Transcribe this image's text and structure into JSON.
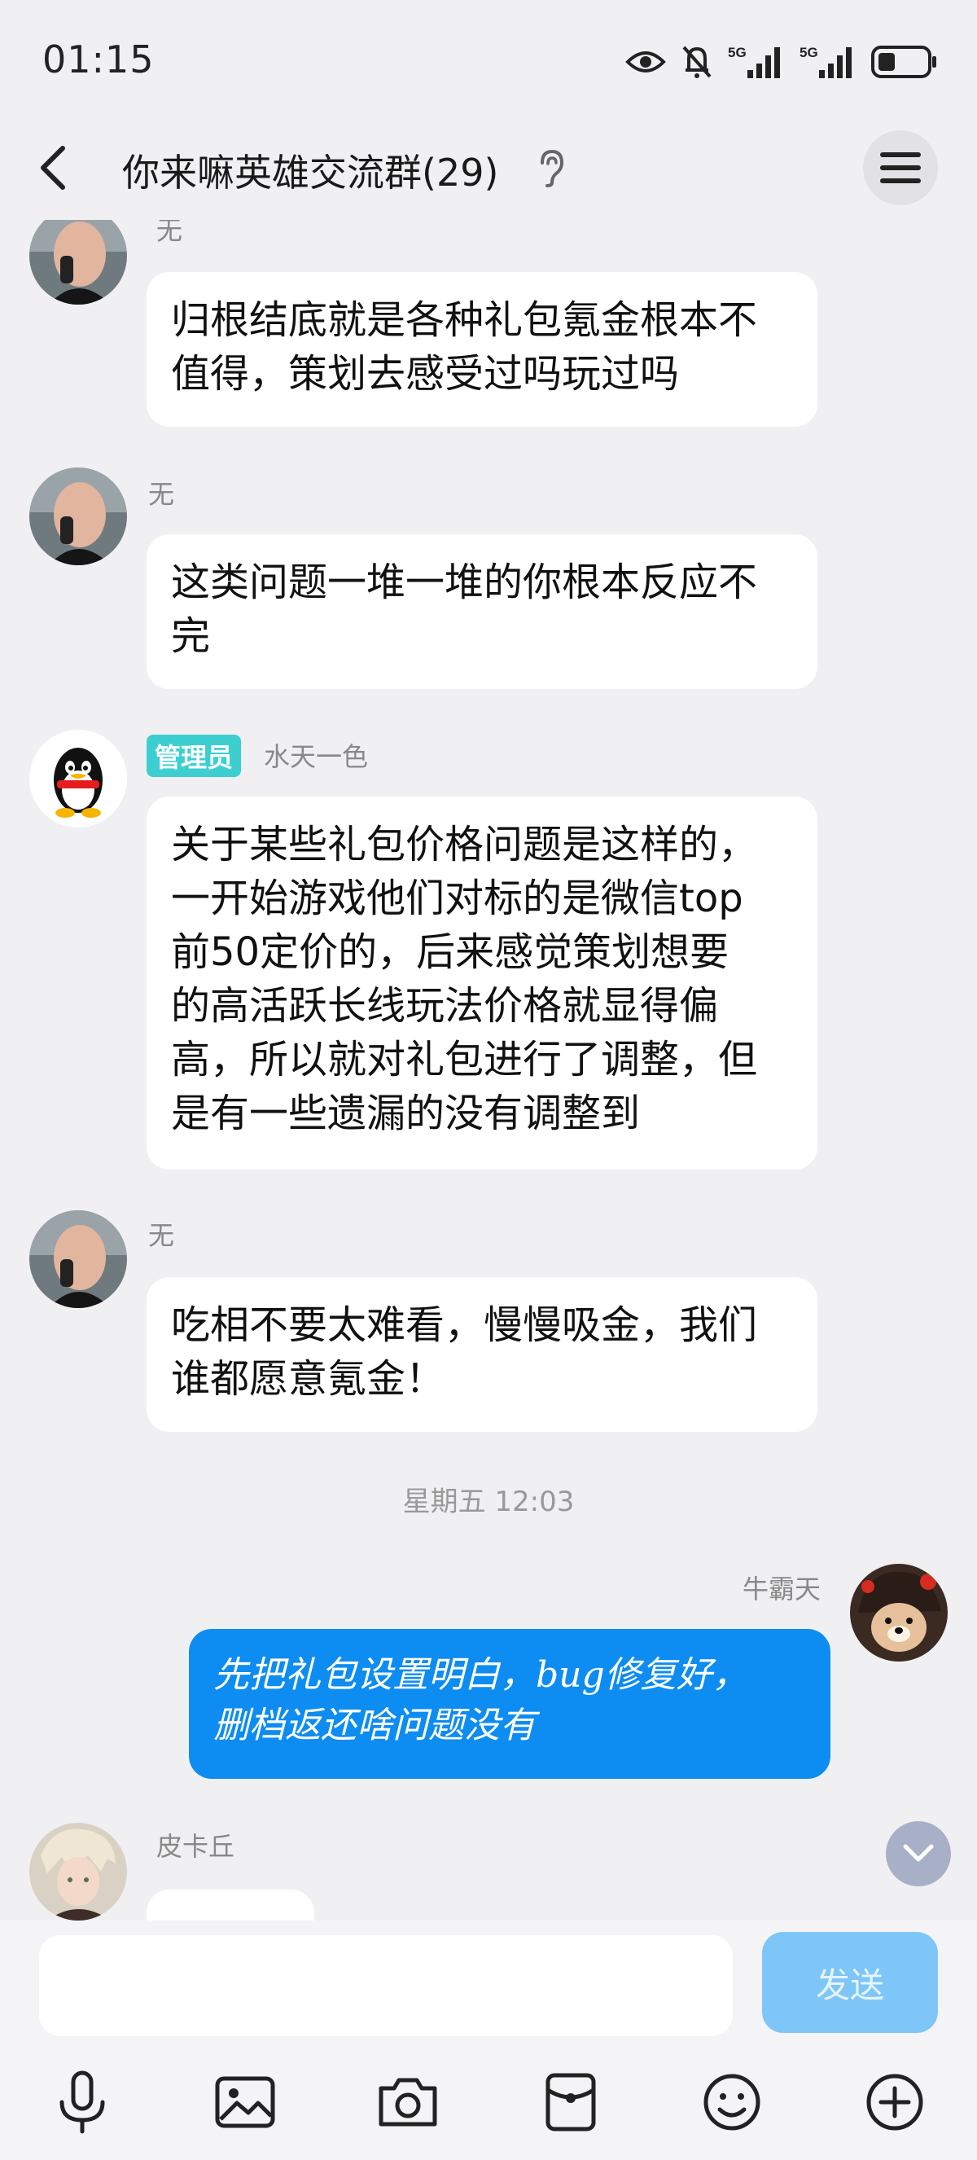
{
  "status_bar": {
    "time": "01:15",
    "icons": [
      "eye-icon",
      "mute-bell-icon",
      "signal-5g-icon",
      "signal-5g-icon",
      "battery-icon"
    ],
    "network_label_1": "5G",
    "network_label_2": "5G"
  },
  "header": {
    "title": "你来嘛英雄交流群(29)",
    "icons": [
      "back-icon",
      "ear-icon",
      "menu-icon"
    ]
  },
  "messages": [
    {
      "sender": "无",
      "text_lines": [
        "归根结底就是各种礼包氪金根本不",
        "值得，策划去感受过吗玩过吗"
      ]
    },
    {
      "sender": "无",
      "text_lines": [
        "这类问题一堆一堆的你根本反应不",
        "完"
      ]
    },
    {
      "badge": "管理员",
      "sender": "水天一色",
      "text_lines": [
        "关于某些礼包价格问题是这样的，",
        "一开始游戏他们对标的是微信top",
        "前50定价的，后来感觉策划想要",
        "的高活跃长线玩法价格就显得偏",
        "高，所以就对礼包进行了调整，但",
        "是有一些遗漏的没有调整到"
      ]
    },
    {
      "sender": "无",
      "text_lines": [
        "吃相不要太难看，慢慢吸金，我们",
        "谁都愿意氪金！"
      ]
    },
    {
      "timestamp": "星期五 12:03"
    },
    {
      "sender": "牛霸天",
      "self": true,
      "text_lines": [
        "先把礼包设置明白，bug修复好，",
        "删档返还啥问题没有"
      ]
    },
    {
      "sender": "皮卡丘",
      "text_lines": [
        ""
      ]
    }
  ],
  "input": {
    "placeholder": "",
    "value": "",
    "send_label": "发送"
  },
  "toolbar": [
    "microphone-icon",
    "image-icon",
    "camera-icon",
    "red-packet-icon",
    "emoji-icon",
    "plus-icon"
  ],
  "colors": {
    "background": "#f0f0f2",
    "self_bubble": "#0d8cf2",
    "admin_badge": "#3dcfd0",
    "send_button": "#7ec6f7"
  }
}
